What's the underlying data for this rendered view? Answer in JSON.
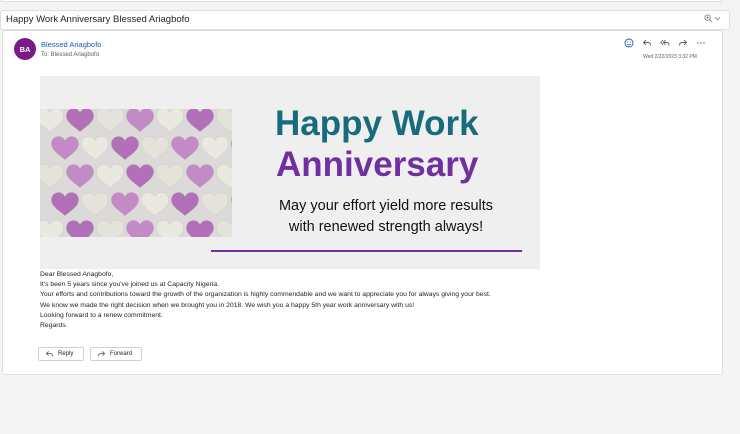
{
  "subject": "Happy Work Anniversary Blessed Ariagbofo",
  "header": {
    "avatar_initials": "BA",
    "sender_name": "Blessed Ariagbofo",
    "to_line": "To:  Blessed Ariagbofo",
    "timestamp": "Wed 2/22/2023 3:32 PM",
    "actions": [
      "emoji-icon",
      "reply-icon",
      "reply-all-icon",
      "forward-icon",
      "more-icon"
    ]
  },
  "banner": {
    "title_line1": "Happy Work",
    "title_line2": "Anniversary",
    "message_line1": "May your effort yield more results",
    "message_line2": "with renewed strength always!",
    "colors": {
      "title1": "#176b7d",
      "title2": "#7030a0",
      "rule": "#7030a0"
    }
  },
  "body": {
    "lines": [
      "Dear Blessed Ariagbofo,",
      "It's been  5 years since you've joined us at Capacity Nigeria.",
      "Your efforts and contributions toward the growth of the organization is highly commendable and we want to appreciate you for always giving your best.",
      "We know we made the right decision when we brought you in 2018. We wish you a happy 5th year work anniversary with us!",
      "Looking forward to a renew commitment.",
      "Regards."
    ]
  },
  "footer": {
    "reply_label": "Reply",
    "forward_label": "Forward"
  },
  "colors": {
    "accent": "#1a5bb5",
    "avatar": "#7a1a86"
  }
}
